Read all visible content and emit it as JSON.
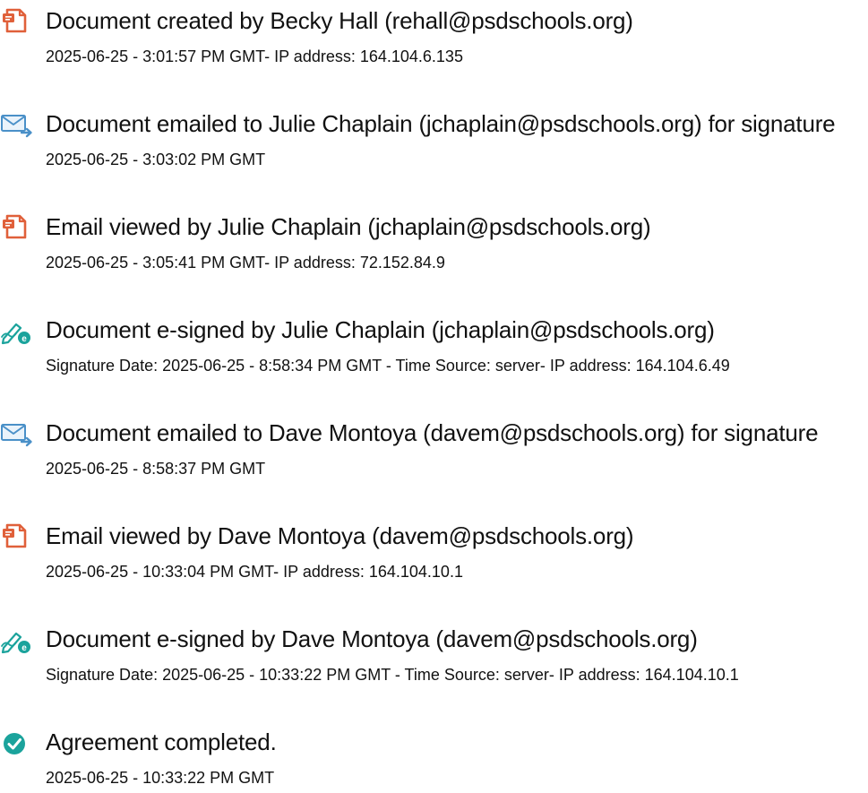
{
  "colors": {
    "document_icon": "#e0603a",
    "email_icon": "#4a90c8",
    "sign_icon": "#1ba39c",
    "completed_icon": "#1ba39c",
    "text": "#111111"
  },
  "events": [
    {
      "icon": "document-icon",
      "title": "Document created by Becky Hall (rehall@psdschools.org)",
      "detail": "2025-06-25 - 3:01:57 PM GMT- IP address: 164.104.6.135"
    },
    {
      "icon": "email-icon",
      "title": "Document emailed to Julie Chaplain (jchaplain@psdschools.org) for signature",
      "detail": "2025-06-25 - 3:03:02 PM GMT"
    },
    {
      "icon": "document-icon",
      "title": "Email viewed by Julie Chaplain (jchaplain@psdschools.org)",
      "detail": "2025-06-25 - 3:05:41 PM GMT- IP address: 72.152.84.9"
    },
    {
      "icon": "esign-icon",
      "title": "Document e-signed by Julie Chaplain (jchaplain@psdschools.org)",
      "detail": "Signature Date: 2025-06-25 - 8:58:34 PM GMT - Time Source: server- IP address: 164.104.6.49"
    },
    {
      "icon": "email-icon",
      "title": "Document emailed to Dave Montoya (davem@psdschools.org) for signature",
      "detail": "2025-06-25 - 8:58:37 PM GMT"
    },
    {
      "icon": "document-icon",
      "title": "Email viewed by Dave Montoya (davem@psdschools.org)",
      "detail": "2025-06-25 - 10:33:04 PM GMT- IP address: 164.104.10.1"
    },
    {
      "icon": "esign-icon",
      "title": "Document e-signed by Dave Montoya (davem@psdschools.org)",
      "detail": "Signature Date: 2025-06-25 - 10:33:22 PM GMT - Time Source: server- IP address: 164.104.10.1"
    },
    {
      "icon": "check-circle-icon",
      "title": "Agreement completed.",
      "detail": "2025-06-25 - 10:33:22 PM GMT"
    }
  ]
}
